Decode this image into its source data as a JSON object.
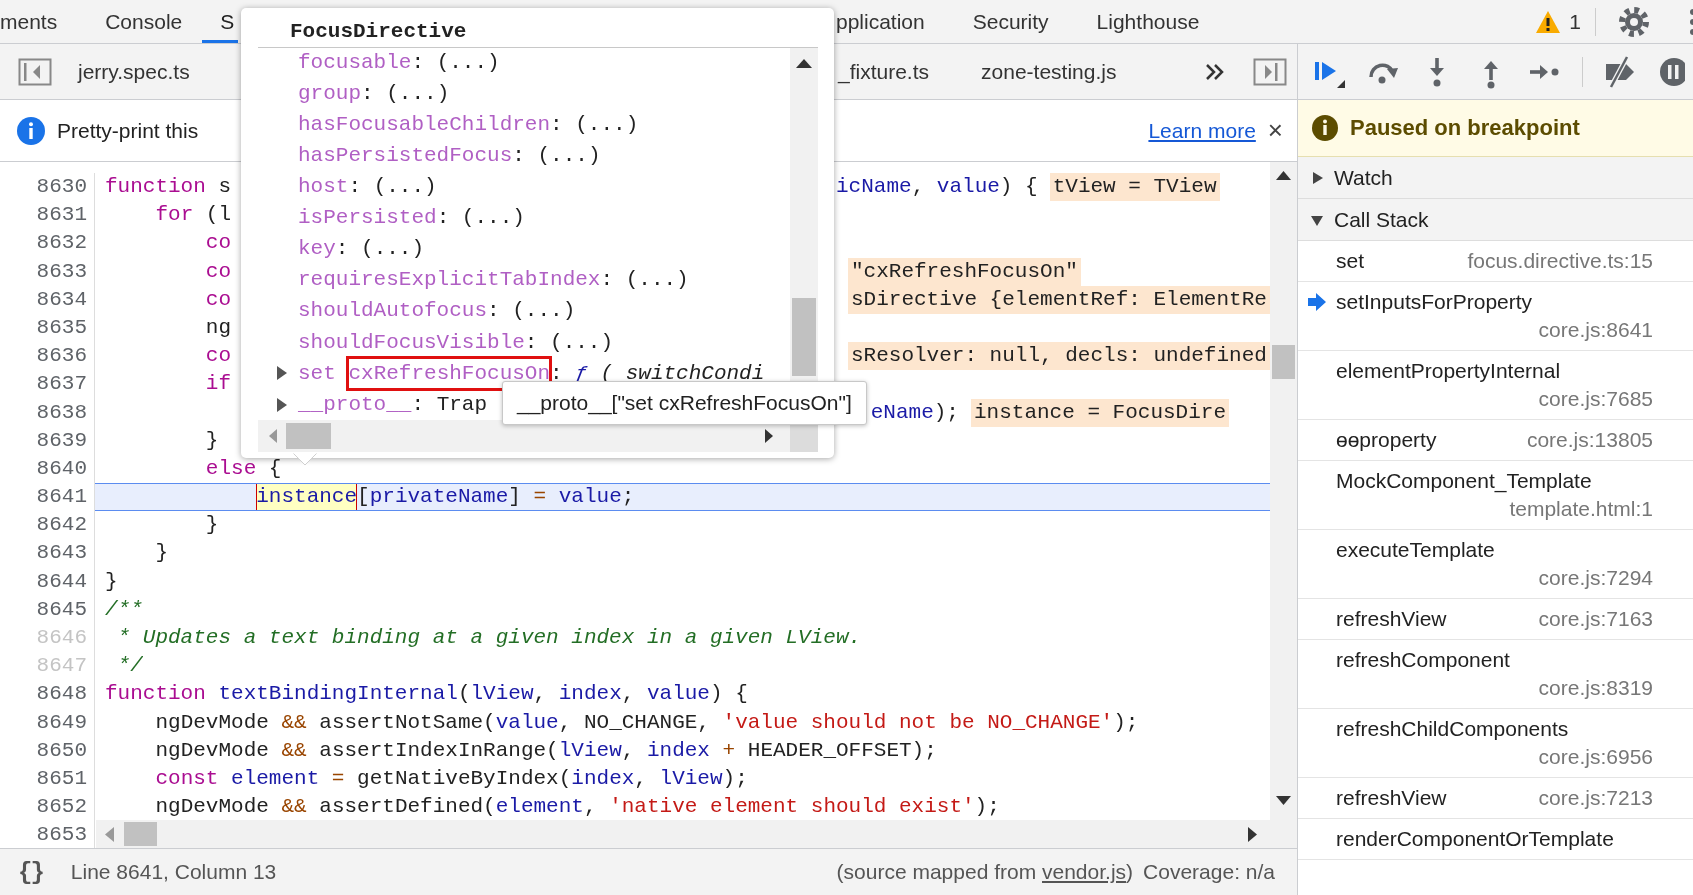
{
  "tabs_left": [
    {
      "label": "ments",
      "selected": false
    },
    {
      "label": "Console",
      "selected": false
    },
    {
      "label": "S",
      "selected": true
    }
  ],
  "tabs_right": [
    {
      "label": "pplication",
      "selected": false
    },
    {
      "label": "Security",
      "selected": false
    },
    {
      "label": "Lighthouse",
      "selected": false
    }
  ],
  "warnings": {
    "count": "1"
  },
  "file_tabs_left": [
    {
      "label": "jerry.spec.ts"
    }
  ],
  "file_tabs_right": [
    {
      "label": "_fixture.ts"
    },
    {
      "label": "zone-testing.js"
    }
  ],
  "info_bar": {
    "message": "Pretty-print this",
    "link": "Learn more",
    "close": "×"
  },
  "code": {
    "lines": [
      {
        "number": "8630",
        "muted": false,
        "current": false,
        "tokens": [
          {
            "kind": "keyword",
            "text": "function"
          },
          {
            "kind": "plain",
            "text": " s"
          }
        ],
        "right": [
          {
            "kind": "name",
            "text": "icName"
          },
          {
            "kind": "plain",
            "text": ", "
          },
          {
            "kind": "name",
            "text": "value"
          },
          {
            "kind": "plain",
            "text": ") {"
          },
          {
            "kind": "inline_value",
            "text": "tView = TView"
          }
        ]
      },
      {
        "number": "8631",
        "muted": false,
        "current": false,
        "tokens": [
          {
            "kind": "keyword",
            "text": "    for"
          },
          {
            "kind": "plain",
            "text": " (l"
          }
        ]
      },
      {
        "number": "8632",
        "muted": false,
        "current": false,
        "tokens": [
          {
            "kind": "keyword",
            "text": "        co"
          }
        ]
      },
      {
        "number": "8633",
        "muted": false,
        "current": false,
        "tokens": [
          {
            "kind": "keyword",
            "text": "        co"
          }
        ],
        "right": [
          {
            "kind": "inline_value",
            "text": "\"cxRefreshFocusOn\""
          }
        ]
      },
      {
        "number": "8634",
        "muted": false,
        "current": false,
        "tokens": [
          {
            "kind": "keyword",
            "text": "        co"
          }
        ],
        "right": [
          {
            "kind": "inline_value",
            "text": "sDirective {elementRef: ElementRe"
          }
        ]
      },
      {
        "number": "8635",
        "muted": false,
        "current": false,
        "tokens": [
          {
            "kind": "plain",
            "text": "        ng"
          }
        ]
      },
      {
        "number": "8636",
        "muted": false,
        "current": false,
        "tokens": [
          {
            "kind": "keyword",
            "text": "        co"
          }
        ],
        "right": [
          {
            "kind": "inline_value",
            "text": "sResolver: null, decls: undefined"
          }
        ]
      },
      {
        "number": "8637",
        "muted": false,
        "current": false,
        "tokens": [
          {
            "kind": "keyword",
            "text": "        if"
          }
        ]
      },
      {
        "number": "8638",
        "muted": false,
        "current": false,
        "right": [
          {
            "kind": "name",
            "text": "eName"
          },
          {
            "kind": "plain",
            "text": ");"
          },
          {
            "kind": "inline_value",
            "text": "instance = FocusDire"
          }
        ]
      },
      {
        "number": "8639",
        "muted": false,
        "current": false,
        "tokens": [
          {
            "kind": "plain",
            "text": "        }"
          }
        ]
      },
      {
        "number": "8640",
        "muted": false,
        "current": false,
        "tokens": [
          {
            "kind": "keyword",
            "text": "        else"
          },
          {
            "kind": "plain",
            "text": " {"
          }
        ]
      },
      {
        "number": "8641",
        "muted": false,
        "current": true,
        "tokens": [
          {
            "kind": "hovered",
            "text": "            instance"
          },
          {
            "kind": "plain",
            "text": "["
          },
          {
            "kind": "name",
            "text": "privateName"
          },
          {
            "kind": "plain",
            "text": "] "
          },
          {
            "kind": "operator",
            "text": "= "
          },
          {
            "kind": "name",
            "text": "value"
          },
          {
            "kind": "plain",
            "text": ";"
          }
        ]
      },
      {
        "number": "8642",
        "muted": false,
        "current": false,
        "tokens": [
          {
            "kind": "plain",
            "text": "        }"
          }
        ]
      },
      {
        "number": "8643",
        "muted": false,
        "current": false,
        "tokens": [
          {
            "kind": "plain",
            "text": "    }"
          }
        ]
      },
      {
        "number": "8644",
        "muted": false,
        "current": false,
        "tokens": [
          {
            "kind": "plain",
            "text": "}"
          }
        ]
      },
      {
        "number": "8645",
        "muted": false,
        "current": false,
        "tokens": [
          {
            "kind": "comment",
            "text": "/**"
          }
        ]
      },
      {
        "number": "8646",
        "muted": true,
        "current": false,
        "tokens": [
          {
            "kind": "comment",
            "text": " * Updates a text binding at a given index in a given LView."
          }
        ]
      },
      {
        "number": "8647",
        "muted": true,
        "current": false,
        "tokens": [
          {
            "kind": "comment",
            "text": " */"
          }
        ]
      },
      {
        "number": "8648",
        "muted": false,
        "current": false,
        "tokens": [
          {
            "kind": "keyword",
            "text": "function "
          },
          {
            "kind": "name",
            "text": "textBindingInternal"
          },
          {
            "kind": "plain",
            "text": "("
          },
          {
            "kind": "name",
            "text": "lView"
          },
          {
            "kind": "plain",
            "text": ", "
          },
          {
            "kind": "name",
            "text": "index"
          },
          {
            "kind": "plain",
            "text": ", "
          },
          {
            "kind": "name",
            "text": "value"
          },
          {
            "kind": "plain",
            "text": ") {"
          }
        ]
      },
      {
        "number": "8649",
        "muted": false,
        "current": false,
        "tokens": [
          {
            "kind": "plain",
            "text": "    ngDevMode "
          },
          {
            "kind": "operator",
            "text": "&&"
          },
          {
            "kind": "plain",
            "text": " assertNotSame("
          },
          {
            "kind": "name",
            "text": "value"
          },
          {
            "kind": "plain",
            "text": ", NO_CHANGE, "
          },
          {
            "kind": "string",
            "text": "'value should not be NO_CHANGE'"
          },
          {
            "kind": "plain",
            "text": ");"
          }
        ]
      },
      {
        "number": "8650",
        "muted": false,
        "current": false,
        "tokens": [
          {
            "kind": "plain",
            "text": "    ngDevMode "
          },
          {
            "kind": "operator",
            "text": "&&"
          },
          {
            "kind": "plain",
            "text": " assertIndexInRange("
          },
          {
            "kind": "name",
            "text": "lView"
          },
          {
            "kind": "plain",
            "text": ", "
          },
          {
            "kind": "name",
            "text": "index"
          },
          {
            "kind": "operator",
            "text": " +"
          },
          {
            "kind": "plain",
            "text": " HEADER_OFFSET);"
          }
        ]
      },
      {
        "number": "8651",
        "muted": false,
        "current": false,
        "tokens": [
          {
            "kind": "keyword",
            "text": "    const "
          },
          {
            "kind": "name",
            "text": "element"
          },
          {
            "kind": "operator",
            "text": " ="
          },
          {
            "kind": "plain",
            "text": " getNativeByIndex("
          },
          {
            "kind": "name",
            "text": "index"
          },
          {
            "kind": "plain",
            "text": ", "
          },
          {
            "kind": "name",
            "text": "lView"
          },
          {
            "kind": "plain",
            "text": ");"
          }
        ]
      },
      {
        "number": "8652",
        "muted": false,
        "current": false,
        "tokens": [
          {
            "kind": "plain",
            "text": "    ngDevMode "
          },
          {
            "kind": "operator",
            "text": "&&"
          },
          {
            "kind": "plain",
            "text": " assertDefined("
          },
          {
            "kind": "name",
            "text": "element"
          },
          {
            "kind": "plain",
            "text": ", "
          },
          {
            "kind": "string",
            "text": "'native element should exist'"
          },
          {
            "kind": "plain",
            "text": ");"
          }
        ]
      },
      {
        "number": "8653",
        "muted": false,
        "current": false
      }
    ]
  },
  "popover": {
    "title": "FocusDirective",
    "properties": [
      {
        "kind": "getter",
        "name": "focusable",
        "separator": ":",
        "value": "(...)",
        "marked": false
      },
      {
        "kind": "getter",
        "name": "group",
        "separator": ":",
        "value": "(...)",
        "marked": false
      },
      {
        "kind": "getter",
        "name": "hasFocusableChildren",
        "separator": ":",
        "value": "(...)",
        "marked": false
      },
      {
        "kind": "getter",
        "name": "hasPersistedFocus",
        "separator": ":",
        "value": "(...)",
        "marked": false
      },
      {
        "kind": "getter",
        "name": "host",
        "separator": ":",
        "value": "(...)",
        "marked": false
      },
      {
        "kind": "getter",
        "name": "isPersisted",
        "separator": ":",
        "value": "(...)",
        "marked": false
      },
      {
        "kind": "getter",
        "name": "key",
        "separator": ":",
        "value": "(...)",
        "marked": false
      },
      {
        "kind": "getter",
        "name": "requiresExplicitTabIndex",
        "separator": ":",
        "value": "(...)",
        "marked": false
      },
      {
        "kind": "getter",
        "name": "shouldAutofocus",
        "separator": ":",
        "value": "(...)",
        "marked": false
      },
      {
        "kind": "getter",
        "name": "shouldFocusVisible",
        "separator": ":",
        "value": "(...)",
        "marked": false
      },
      {
        "kind": "expandable",
        "expanded": false,
        "prefix": "set",
        "name": "cxRefreshFocusOn",
        "separator": ":",
        "value_type": "ƒ",
        "value": "( switchCondi",
        "marked": true
      },
      {
        "kind": "expandable",
        "expanded": false,
        "name": "__proto__",
        "separator": ":",
        "value": "Trap",
        "marked": false
      }
    ]
  },
  "tooltip": "__proto__[\"set cxRefreshFocusOn\"]",
  "status_bar": {
    "format_button": "{}",
    "position": "Line 8641, Column 13",
    "source_prefix": "(source mapped from ",
    "source_link": "vendor.js",
    "source_suffix": ")",
    "coverage": "Coverage: n/a"
  },
  "debugger": {
    "banner": "Paused on breakpoint",
    "sections": [
      {
        "label": "Watch",
        "expanded": false
      },
      {
        "label": "Call Stack",
        "expanded": true
      }
    ],
    "frames": [
      {
        "name": "set",
        "location": "focus.directive.ts:15",
        "selected": false
      },
      {
        "name": "setInputsForProperty",
        "location": "core.js:8641",
        "selected": true
      },
      {
        "name": "elementPropertyInternal",
        "location": "core.js:7685",
        "selected": false
      },
      {
        "name": "ɵɵproperty",
        "location": "core.js:13805",
        "selected": false
      },
      {
        "name": "MockComponent_Template",
        "location": "template.html:1",
        "selected": false
      },
      {
        "name": "executeTemplate",
        "location": "core.js:7294",
        "selected": false
      },
      {
        "name": "refreshView",
        "location": "core.js:7163",
        "selected": false
      },
      {
        "name": "refreshComponent",
        "location": "core.js:8319",
        "selected": false
      },
      {
        "name": "refreshChildComponents",
        "location": "core.js:6956",
        "selected": false
      },
      {
        "name": "refreshView",
        "location": "core.js:7213",
        "selected": false
      },
      {
        "name": "renderComponentOrTemplate",
        "selected": false
      }
    ]
  }
}
